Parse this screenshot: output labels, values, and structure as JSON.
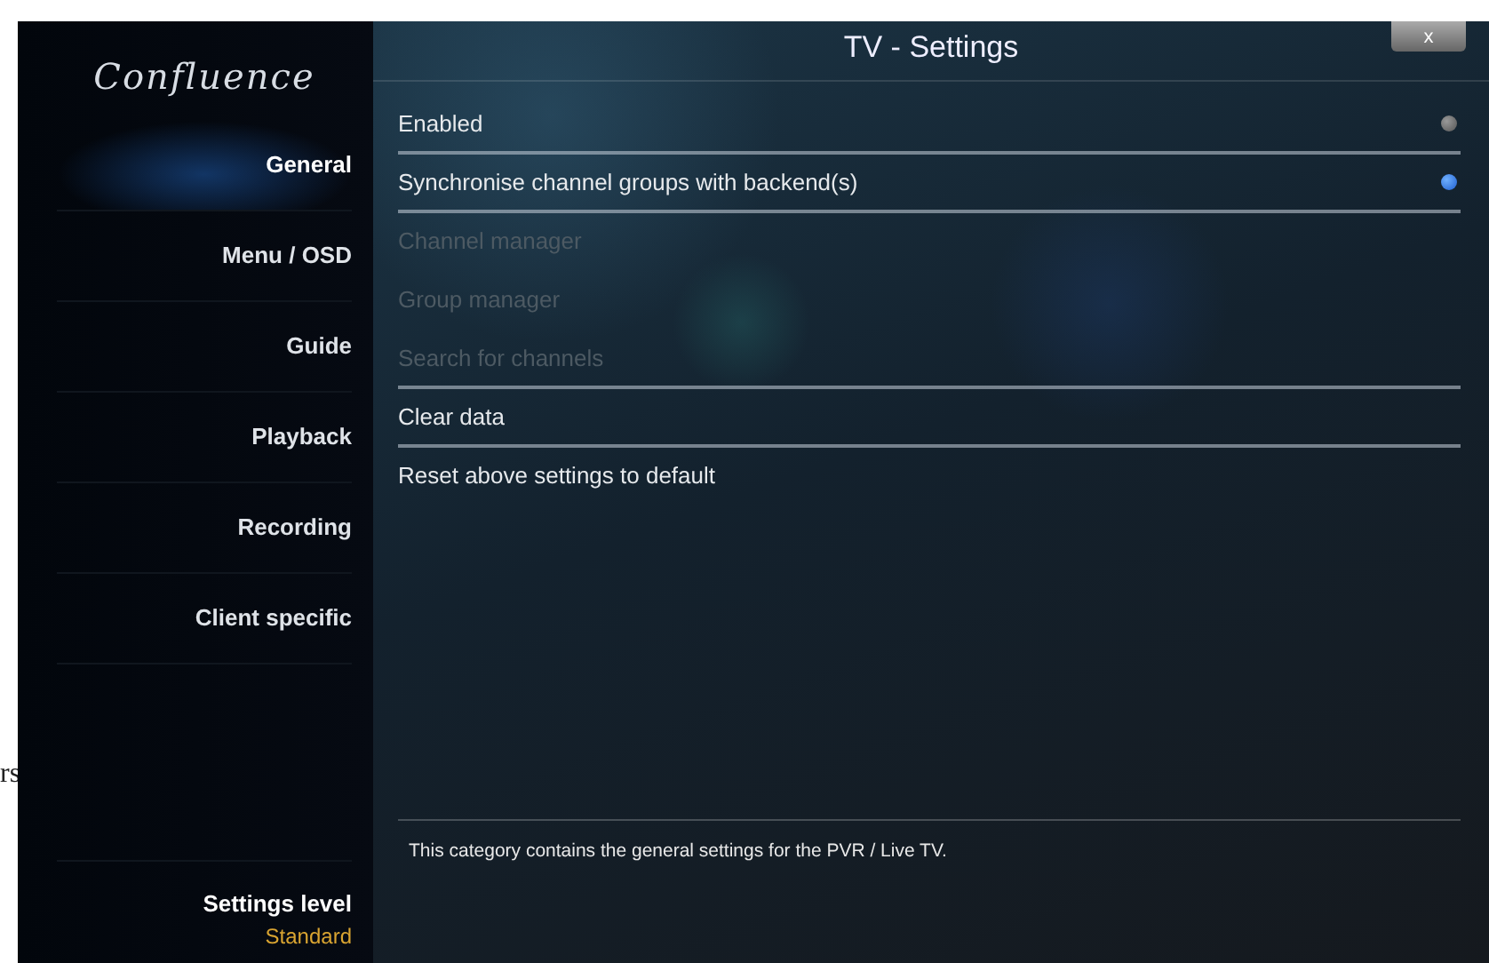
{
  "stray_text": "rs",
  "sidebar": {
    "logo": "Confluence",
    "items": [
      {
        "label": "General",
        "selected": true
      },
      {
        "label": "Menu / OSD",
        "selected": false
      },
      {
        "label": "Guide",
        "selected": false
      },
      {
        "label": "Playback",
        "selected": false
      },
      {
        "label": "Recording",
        "selected": false
      },
      {
        "label": "Client specific",
        "selected": false
      }
    ],
    "settings_level": {
      "label": "Settings level",
      "value": "Standard"
    }
  },
  "window": {
    "title": "TV - Settings",
    "close": "x"
  },
  "settings": [
    {
      "label": "Enabled",
      "kind": "toggle",
      "on": false,
      "disabled": false
    },
    {
      "label": "Synchronise channel groups with backend(s)",
      "kind": "toggle",
      "on": true,
      "disabled": false
    },
    {
      "label": "Channel manager",
      "kind": "action",
      "disabled": true
    },
    {
      "label": "Group manager",
      "kind": "action",
      "disabled": true
    },
    {
      "label": "Search for channels",
      "kind": "action",
      "disabled": true
    },
    {
      "label": "Clear data",
      "kind": "action",
      "disabled": false
    },
    {
      "label": "Reset above settings to default",
      "kind": "action",
      "disabled": false
    }
  ],
  "description": "This category contains the general settings for the PVR / Live TV."
}
